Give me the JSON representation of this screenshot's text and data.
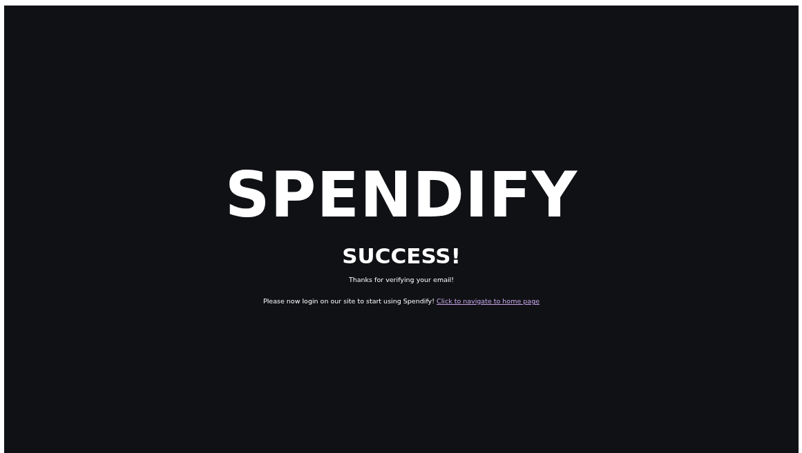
{
  "logo": "SPENDIFY",
  "heading": "SUCCESS!",
  "message": "Thanks for verifying your email!",
  "instruction": {
    "text": "Please now login on our site to start using Spendify!",
    "link": "Click to navigate to home page"
  }
}
